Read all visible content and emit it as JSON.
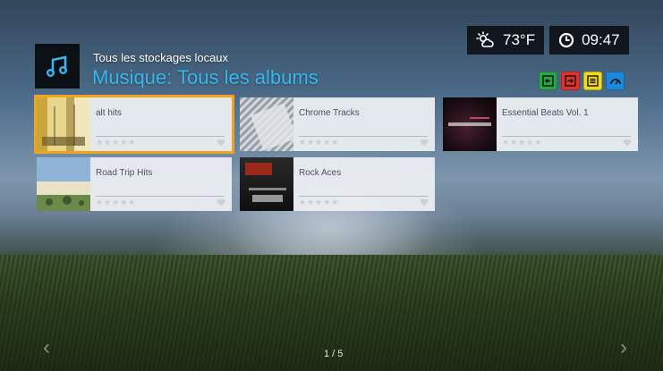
{
  "status": {
    "weather_icon": "weather-sun-cloud-icon",
    "temperature": "73°F",
    "clock_icon": "clock-icon",
    "time": "09:47"
  },
  "header": {
    "app_icon": "music-note-icon",
    "breadcrumb": "Tous les stockages locaux",
    "title": "Musique: Tous les albums"
  },
  "color_keys": [
    {
      "name": "green-key",
      "color": "#2aa548",
      "icon": "box-arrow-left-icon"
    },
    {
      "name": "red-key",
      "color": "#e0332b",
      "icon": "box-arrow-right-icon"
    },
    {
      "name": "yellow-key",
      "color": "#f0dc1c",
      "icon": "list-icon"
    },
    {
      "name": "blue-key",
      "color": "#1f87d8",
      "icon": "gauge-icon"
    }
  ],
  "albums": [
    {
      "title": "alt hits",
      "rating": "★★★★★",
      "selected": true
    },
    {
      "title": "Chrome Tracks",
      "rating": "★★★★★",
      "selected": false
    },
    {
      "title": "Essential Beats Vol. 1",
      "rating": "★★★★★",
      "selected": false
    },
    {
      "title": "Road Trip Hits",
      "rating": "★★★★★",
      "selected": false
    },
    {
      "title": "Rock Aces",
      "rating": "★★★★★",
      "selected": false
    }
  ],
  "pager": {
    "prev_label": "‹",
    "next_label": "›",
    "page": "1 / 5"
  },
  "colors": {
    "accent": "#38b6f0",
    "selection": "#f2a31b"
  }
}
